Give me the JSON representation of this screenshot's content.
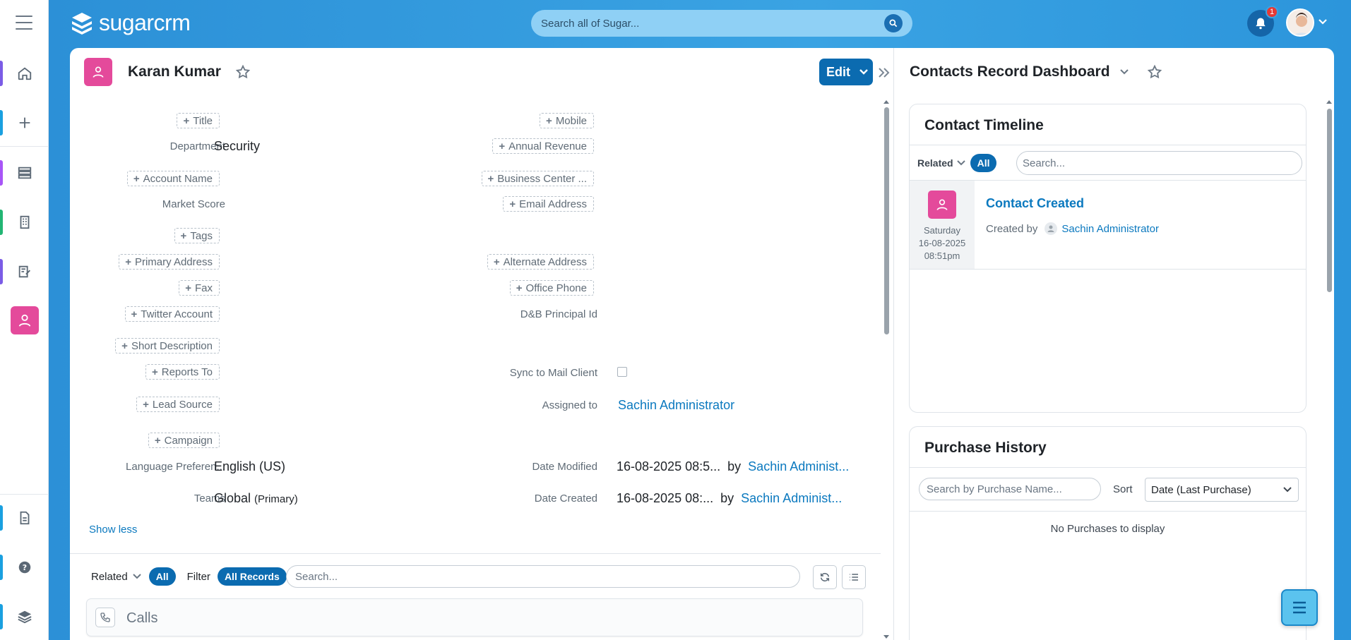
{
  "app": {
    "brand": "sugarcrm"
  },
  "search": {
    "placeholder": "Search all of Sugar..."
  },
  "notifications": {
    "count": "1"
  },
  "record": {
    "name": "Karan Kumar",
    "edit_label": "Edit",
    "fields_left": [
      {
        "label": "Title",
        "empty": true
      },
      {
        "label": "Department",
        "value": "Security"
      },
      {
        "label": "Account Name",
        "empty": true
      },
      {
        "label": "Market Score",
        "value": ""
      },
      {
        "label": "Tags",
        "empty": true
      },
      {
        "label": "Primary Address",
        "empty": true
      },
      {
        "label": "Fax",
        "empty": true
      },
      {
        "label": "Twitter Account",
        "empty": true
      },
      {
        "label": "Short Description",
        "empty": true
      },
      {
        "label": "Reports To",
        "empty": true
      },
      {
        "label": "Lead Source",
        "empty": true
      },
      {
        "label": "Campaign",
        "empty": true
      },
      {
        "label": "Language Preferen...",
        "value": "English (US)"
      },
      {
        "label": "Teams",
        "value": "Global",
        "suffix": "(Primary)"
      }
    ],
    "fields_right": [
      {
        "label": "Mobile",
        "empty": true
      },
      {
        "label": "Annual Revenue",
        "empty": true
      },
      {
        "label": "Business Center ...",
        "empty": true
      },
      {
        "label": "Email Address",
        "empty": true
      },
      {
        "label": "Alternate Address",
        "empty": true
      },
      {
        "label": "Office Phone",
        "empty": true
      },
      {
        "label": "D&B Principal Id",
        "value": ""
      },
      {
        "label": "Sync to Mail Client",
        "checkbox": false
      },
      {
        "label": "Assigned to",
        "value": "Sachin Administrator"
      },
      {
        "label": "Date Modified",
        "value": "16-08-2025 08:5...",
        "by": "by",
        "by_user": "Sachin Administ..."
      },
      {
        "label": "Date Created",
        "value": "16-08-2025 08:...",
        "by": "by",
        "by_user": "Sachin Administ..."
      }
    ],
    "show_less": "Show less"
  },
  "subpanel": {
    "related_label": "Related",
    "all_label": "All",
    "filter_label": "Filter",
    "all_records_label": "All Records",
    "search_placeholder": "Search...",
    "calls_title": "Calls"
  },
  "dashboard": {
    "title": "Contacts Record Dashboard",
    "timeline": {
      "title": "Contact Timeline",
      "related_label": "Related",
      "all_label": "All",
      "search_placeholder": "Search...",
      "entry": {
        "day": "Saturday",
        "date": "16-08-2025",
        "time": "08:51pm",
        "title": "Contact Created",
        "created_by_label": "Created by",
        "user": "Sachin Administrator"
      }
    },
    "purchase": {
      "title": "Purchase History",
      "search_placeholder": "Search by Purchase Name...",
      "sort_label": "Sort",
      "sort_value": "Date (Last Purchase)",
      "empty_text": "No Purchases to display"
    }
  },
  "colors": {
    "brand_blue": "#0b6bb0",
    "contact_pink": "#e44a9b",
    "link": "#0b79bf"
  }
}
